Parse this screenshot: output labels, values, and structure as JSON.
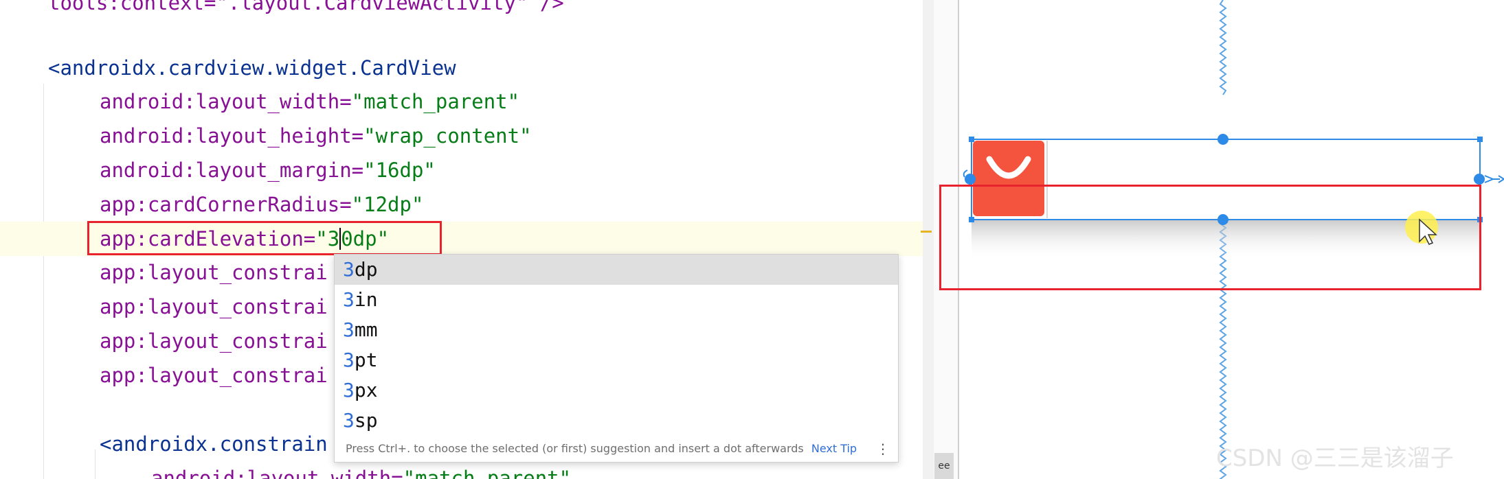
{
  "editor": {
    "lines": [
      {
        "parts": [
          {
            "t": "tools:context=\".layout.CardviewActivity\" />",
            "c": "attr"
          }
        ]
      },
      {
        "parts": [
          {
            "t": "<",
            "c": "tag"
          },
          {
            "t": "androidx.cardview.widget.CardView",
            "c": "tag"
          }
        ]
      },
      {
        "parts": [
          {
            "t": "android:layout_width=",
            "c": "attr"
          },
          {
            "t": "\"match_parent\"",
            "c": "str"
          }
        ]
      },
      {
        "parts": [
          {
            "t": "android:layout_height=",
            "c": "attr"
          },
          {
            "t": "\"wrap_content\"",
            "c": "str"
          }
        ]
      },
      {
        "parts": [
          {
            "t": "android:layout_margin=",
            "c": "attr"
          },
          {
            "t": "\"16dp\"",
            "c": "str"
          }
        ]
      },
      {
        "parts": [
          {
            "t": "app:cardCornerRadius=",
            "c": "attr"
          },
          {
            "t": "\"12dp\"",
            "c": "str"
          }
        ]
      },
      {
        "parts": [
          {
            "t": "app:cardElevation=",
            "c": "attr"
          },
          {
            "t": "\"3",
            "c": "str"
          },
          {
            "t": "|",
            "c": "caret"
          },
          {
            "t": "0dp\"",
            "c": "str"
          }
        ]
      },
      {
        "parts": [
          {
            "t": "app:layout_constrai",
            "c": "attr"
          }
        ]
      },
      {
        "parts": [
          {
            "t": "app:layout_constrai",
            "c": "attr"
          }
        ]
      },
      {
        "parts": [
          {
            "t": "app:layout_constrai",
            "c": "attr"
          }
        ]
      },
      {
        "parts": [
          {
            "t": "app:layout_constrai",
            "c": "attr"
          }
        ]
      },
      {
        "parts": [
          {
            "t": "<",
            "c": "tag"
          },
          {
            "t": "androidx.constrain",
            "c": "tag"
          }
        ]
      },
      {
        "parts": [
          {
            "t": "android:layout_width=",
            "c": "attr"
          },
          {
            "t": "\"match_parent\"",
            "c": "str"
          }
        ]
      }
    ]
  },
  "completion": {
    "typed": "3",
    "items": [
      {
        "prefix": "3",
        "suffix": "dp"
      },
      {
        "prefix": "3",
        "suffix": "in"
      },
      {
        "prefix": "3",
        "suffix": "mm"
      },
      {
        "prefix": "3",
        "suffix": "pt"
      },
      {
        "prefix": "3",
        "suffix": "px"
      },
      {
        "prefix": "3",
        "suffix": "sp"
      }
    ],
    "selected_index": 0,
    "footer_hint": "Press Ctrl+. to choose the selected (or first) suggestion and insert a dot afterwards",
    "next_tip": "Next Tip",
    "more_icon": "⋮"
  },
  "side_tab": {
    "label": "ee"
  },
  "preview": {
    "card_icon": "shopping-bag-icon",
    "accent": "#2d8ae6",
    "icon_color": "#f4533d"
  },
  "watermark": "CSDN @三三是该溜子",
  "colors": {
    "highlight_red": "#e8232e",
    "tag": "#0a3290",
    "attr": "#871094",
    "string": "#067d17"
  }
}
